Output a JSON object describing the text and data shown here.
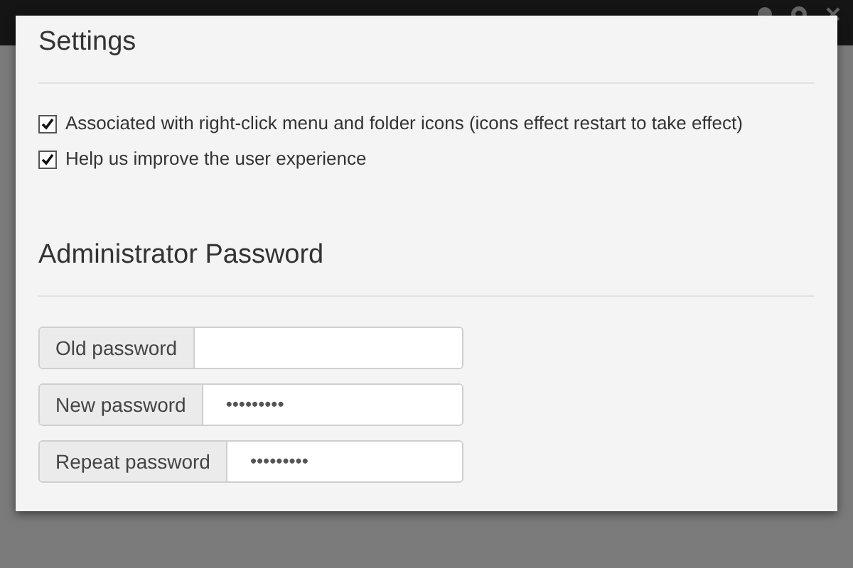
{
  "settings": {
    "title": "Settings",
    "options": [
      {
        "label": "Associated with right-click menu and folder icons (icons effect restart to take effect)",
        "checked": true
      },
      {
        "label": "Help us improve the user experience",
        "checked": true
      }
    ]
  },
  "password": {
    "title": "Administrator Password",
    "fields": [
      {
        "label": "Old password"
      },
      {
        "label": "New password",
        "value": "•••••••••"
      },
      {
        "label": "Repeat password",
        "value": "•••••••••"
      }
    ]
  }
}
